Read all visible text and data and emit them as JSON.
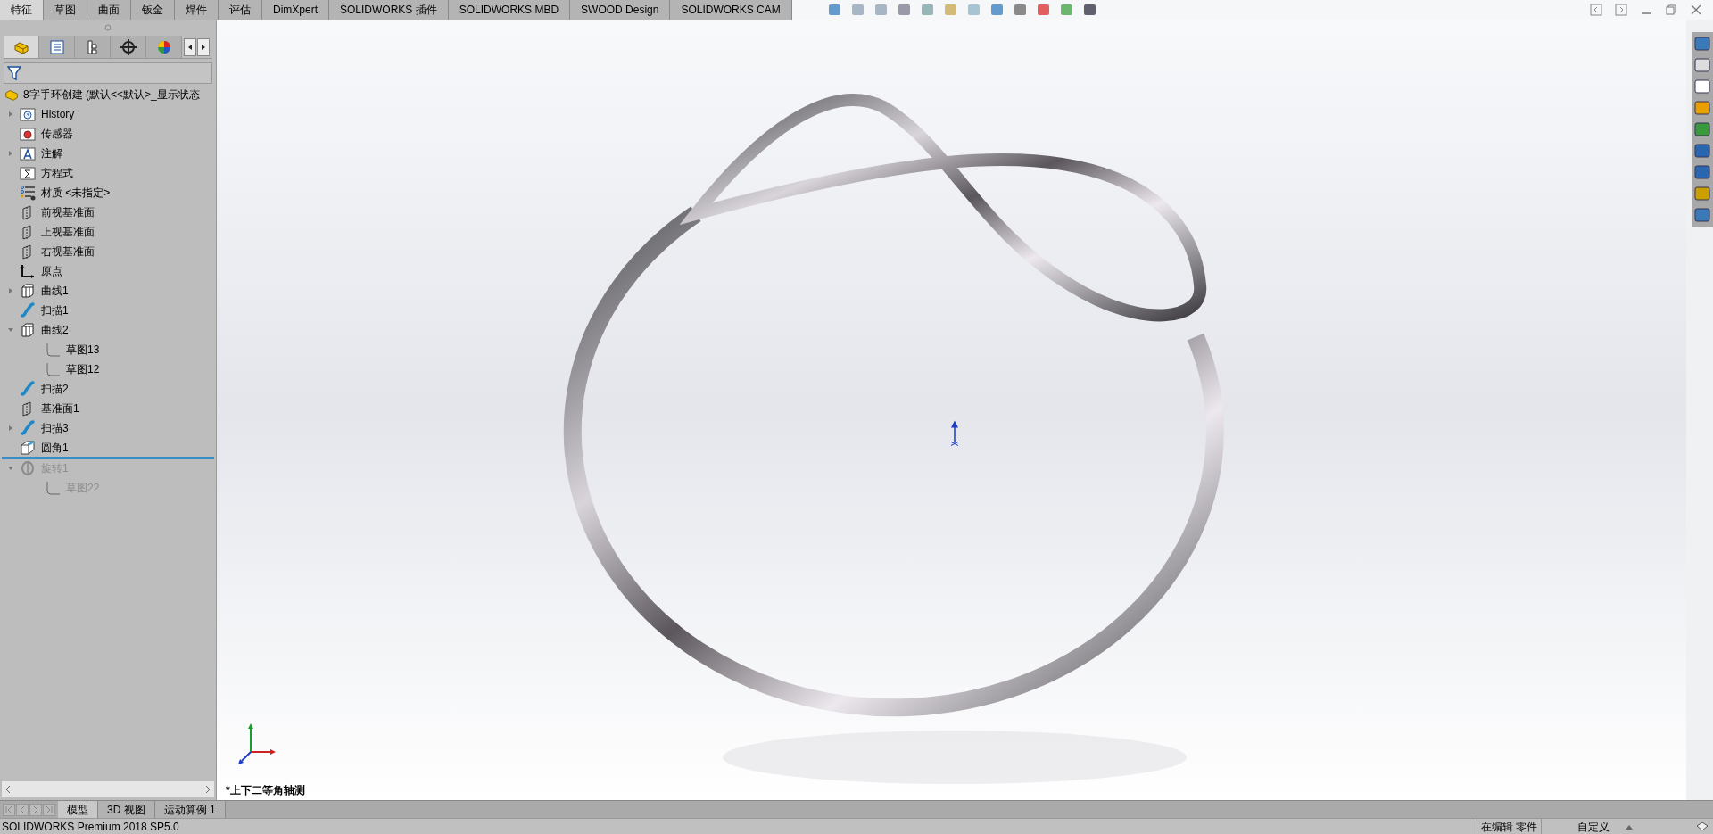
{
  "command_tabs": [
    {
      "label": "特征",
      "selected": true
    },
    {
      "label": "草图",
      "selected": false
    },
    {
      "label": "曲面",
      "selected": false
    },
    {
      "label": "钣金",
      "selected": false
    },
    {
      "label": "焊件",
      "selected": false
    },
    {
      "label": "评估",
      "selected": false
    },
    {
      "label": "DimXpert",
      "selected": false
    },
    {
      "label": "SOLIDWORKS 插件",
      "selected": false
    },
    {
      "label": "SOLIDWORKS MBD",
      "selected": false
    },
    {
      "label": "SWOOD Design",
      "selected": false
    },
    {
      "label": "SOLIDWORKS CAM",
      "selected": false
    }
  ],
  "panel_tabs": [
    {
      "kind": "feature_manager",
      "selected": true
    },
    {
      "kind": "property_manager",
      "selected": false
    },
    {
      "kind": "configuration_manager",
      "selected": false
    },
    {
      "kind": "dimxpert_manager",
      "selected": false
    },
    {
      "kind": "display_manager",
      "selected": false
    }
  ],
  "feature_tree": {
    "root": "8字手环创建  (默认<<默认>_显示状态",
    "items": [
      {
        "kind": "history",
        "label": "History",
        "expandable": true,
        "expanded": false,
        "disabled": false
      },
      {
        "kind": "sensor",
        "label": "传感器",
        "expandable": false,
        "disabled": false
      },
      {
        "kind": "annotation",
        "label": "注解",
        "expandable": true,
        "expanded": false,
        "disabled": false
      },
      {
        "kind": "equation",
        "label": "方程式",
        "expandable": false,
        "disabled": false
      },
      {
        "kind": "material",
        "label": "材质 <未指定>",
        "expandable": false,
        "disabled": false
      },
      {
        "kind": "plane",
        "label": "前视基准面",
        "expandable": false,
        "disabled": false
      },
      {
        "kind": "plane",
        "label": "上视基准面",
        "expandable": false,
        "disabled": false
      },
      {
        "kind": "plane",
        "label": "右视基准面",
        "expandable": false,
        "disabled": false
      },
      {
        "kind": "origin",
        "label": "原点",
        "expandable": false,
        "disabled": false
      },
      {
        "kind": "curve",
        "label": "曲线1",
        "expandable": true,
        "expanded": false,
        "disabled": false
      },
      {
        "kind": "sweep",
        "label": "扫描1",
        "expandable": false,
        "disabled": false
      },
      {
        "kind": "curve",
        "label": "曲线2",
        "expandable": true,
        "expanded": true,
        "disabled": false,
        "children": [
          {
            "kind": "sketch",
            "label": "草图13",
            "disabled": false
          },
          {
            "kind": "sketch",
            "label": "草图12",
            "disabled": false
          }
        ]
      },
      {
        "kind": "sweep",
        "label": "扫描2",
        "expandable": false,
        "disabled": false
      },
      {
        "kind": "plane",
        "label": "基准面1",
        "expandable": false,
        "disabled": false
      },
      {
        "kind": "sweep",
        "label": "扫描3",
        "expandable": true,
        "expanded": false,
        "disabled": false
      },
      {
        "kind": "fillet",
        "label": "圆角1",
        "expandable": false,
        "disabled": false
      },
      {
        "kind": "rollback_bar"
      },
      {
        "kind": "revolve",
        "label": "旋转1",
        "expandable": true,
        "expanded": true,
        "disabled": true,
        "children": [
          {
            "kind": "sketch",
            "label": "草图22",
            "disabled": true
          }
        ]
      }
    ]
  },
  "view_name": "*上下二等角轴测",
  "bottom_tabs": [
    {
      "label": "模型",
      "selected": true
    },
    {
      "label": "3D 视图",
      "selected": false
    },
    {
      "label": "运动算例 1",
      "selected": false
    }
  ],
  "status_bar": {
    "product": "SOLIDWORKS Premium 2018 SP5.0",
    "mode": "在编辑 零件",
    "units": "自定义"
  }
}
